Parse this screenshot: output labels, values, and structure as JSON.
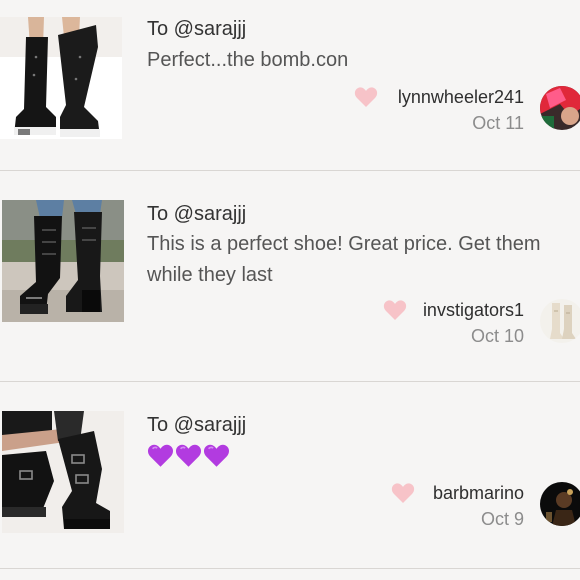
{
  "comments": [
    {
      "to": "To @sarajjj",
      "message": "Perfect...the bomb.con",
      "username": "lynnwheeler241",
      "date": "Oct 11",
      "thumbnail": "knee-high black sneaker boots",
      "avatar": "red-hair profile photo"
    },
    {
      "to": "To @sarajjj",
      "message": "This is a perfect shoe! Great price. Get them while they last",
      "username": "invstigators1",
      "date": "Oct 10",
      "thumbnail": "black patent platform lace-up boots",
      "avatar": "white boots photo"
    },
    {
      "to": "To @sarajjj",
      "message": "💜💜💜",
      "username": "barbmarino",
      "date": "Oct 9",
      "thumbnail": "black buckled platform boots",
      "avatar": "dark profile photo"
    }
  ],
  "colors": {
    "like_heart": "#f7c3c8",
    "purple_heart": "#b23be0",
    "background": "#f6f5f4",
    "divider": "#d9d6d3"
  },
  "icons": {
    "like": "heart-icon",
    "emoji": "purple-heart-icon"
  }
}
